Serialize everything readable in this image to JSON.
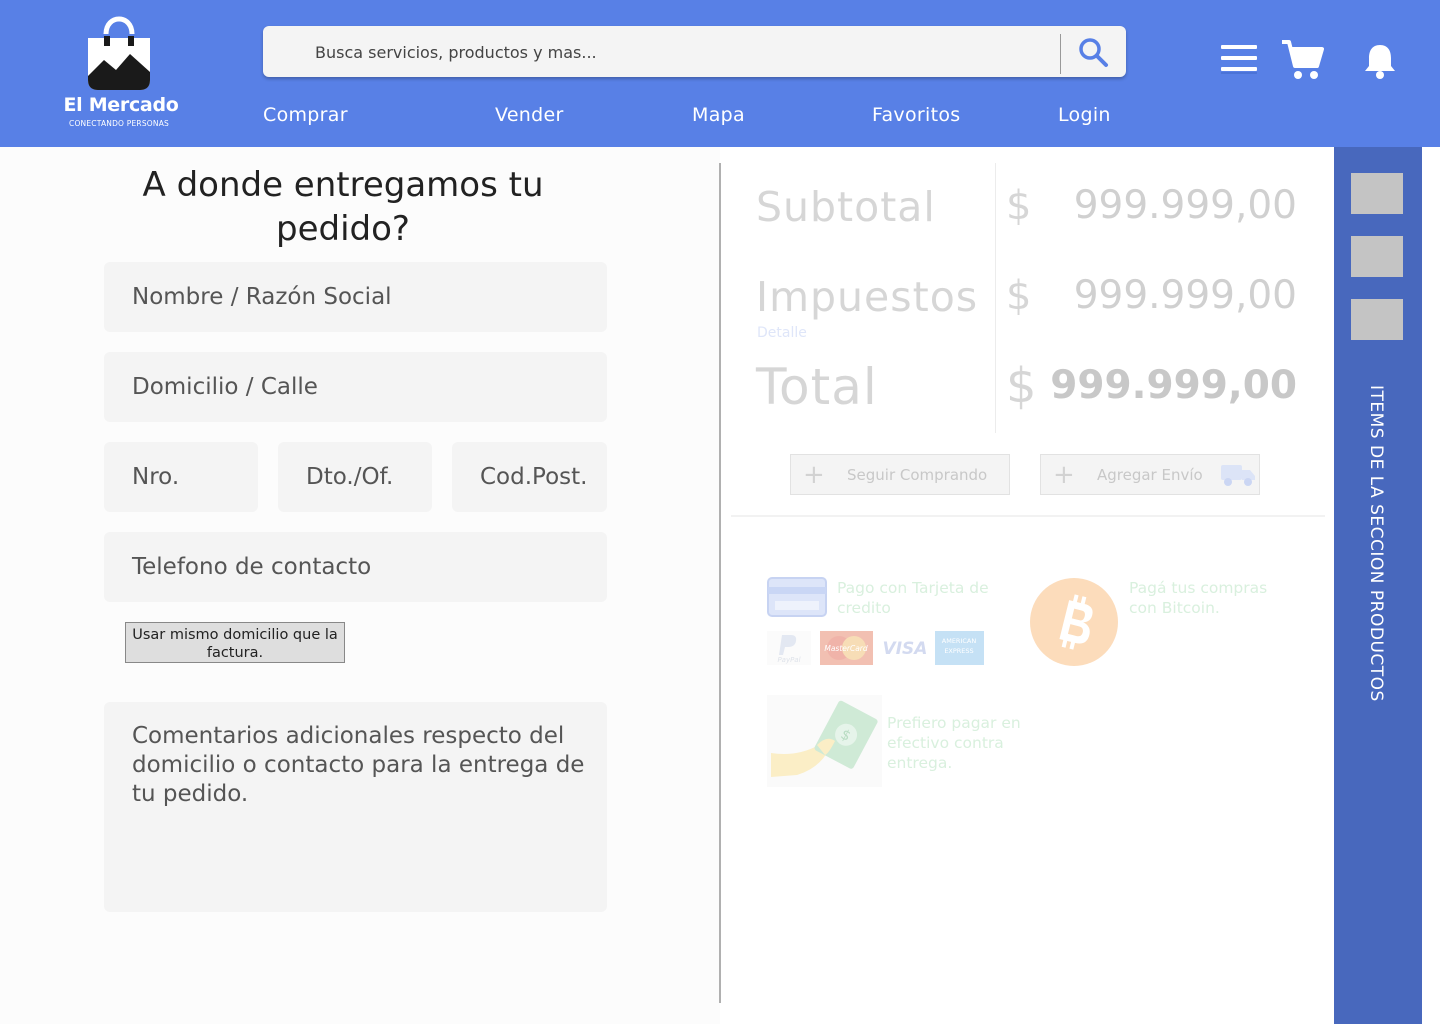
{
  "brand": {
    "name": "El Mercado",
    "tagline": "CONECTANDO PERSONAS"
  },
  "search": {
    "placeholder": "Busca servicios, productos y mas..."
  },
  "nav": [
    "Comprar",
    "Vender",
    "Mapa",
    "Favoritos",
    "Login"
  ],
  "header_icons": [
    "menu-icon",
    "cart-icon",
    "bell-icon"
  ],
  "form": {
    "title": "A donde entregamos tu pedido?",
    "fields": {
      "name": "Nombre / Razón Social",
      "street": "Domicilio / Calle",
      "number": "Nro.",
      "apt": "Dto./Of.",
      "zip": "Cod.Post.",
      "phone": "Telefono de contacto"
    },
    "same_address_button": "Usar mismo domicilio que la factura.",
    "comments_placeholder": "Comentarios adicionales respecto del domicilio o contacto para la entrega de tu pedido."
  },
  "summary": {
    "subtotal_label": "Subtotal",
    "subtotal_currency": "$",
    "subtotal_value": "999.999,00",
    "tax_label": "Impuestos",
    "tax_currency": "$",
    "tax_value": "999.999,00",
    "tax_detail_link": "Detalle",
    "total_label": "Total",
    "total_currency": "$",
    "total_value": "999.999,00"
  },
  "actions": {
    "continue_shopping": "Seguir Comprando",
    "add_shipping": "Agregar Envío"
  },
  "payment": {
    "card_text": "Pago con Tarjeta de credito",
    "bitcoin_text": "Pagá tus compras con Bitcoin.",
    "cash_text": "Prefiero pagar en efectivo contra entrega.",
    "card_logos": {
      "paypal": "PayPal",
      "mastercard": "MasterCard",
      "visa": "VISA",
      "amex": "AMERICAN EXPRESS"
    }
  },
  "sidebar": {
    "label": "ITEMS DE LA SECCION PRODUCTOS",
    "item_count": 3
  },
  "colors": {
    "header": "#5880e6",
    "sidebar": "#4868bd",
    "field_bg": "#f4f4f4",
    "bitcoin": "#f7931a"
  }
}
